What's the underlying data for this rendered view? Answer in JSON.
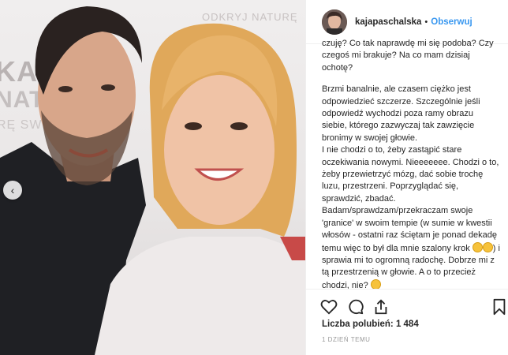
{
  "photo": {
    "wall_logo": "",
    "wall_slogan": "ODKRYJ NATURĘ",
    "wall_big1": "KA",
    "wall_big2": "NATURE",
    "wall_big3": "RĘ SWIE"
  },
  "post": {
    "username": "kajapaschalska",
    "separator": "•",
    "follow_label": "Obserwuj"
  },
  "caption": {
    "paragraph1": "czuję? Co tak naprawdę mi się podoba? Czy czegoś mi brakuje? Na co mam dzisiaj ochotę?",
    "paragraph2_part1": "Brzmi banalnie, ale czasem ciężko jest odpowiedzieć szczerze. Szczególnie jeśli odpowiedź wychodzi poza ramy obrazu siebie, którego zazwyczaj tak zawzięcie bronimy w swojej głowie.\nI nie chodzi o to, żeby zastąpić stare oczekiwania nowymi. Nieeeeeee. Chodzi o to, żeby przewietrzyć mózg, dać sobie trochę luzu, przestrzeni. Poprzyglądać się, sprawdzić, zbadać.\nBadam/sprawdzam/przekraczam swoje 'granice' w swoim tempie (w sumie w kwestii włosów - ostatni raz ściętam je ponad dekadę temu więc to był dla mnie szalony krok",
    "paragraph2_part2": ") i sprawia mi to ogromną radochę. Dobrze mi z tą przestrzenią w głowie. A o to przecież chodzi, nie?"
  },
  "footer": {
    "likes_label": "Liczba polubień:",
    "likes_count": "1 484",
    "timestamp": "1 DZIEŃ TEMU"
  },
  "icons": {
    "carousel_prev": "chevron-left-icon",
    "like": "heart-icon",
    "comment": "comment-icon",
    "share": "share-icon",
    "save": "bookmark-icon"
  },
  "colors": {
    "link_blue": "#3897f0",
    "text": "#262626",
    "muted": "#999999"
  }
}
